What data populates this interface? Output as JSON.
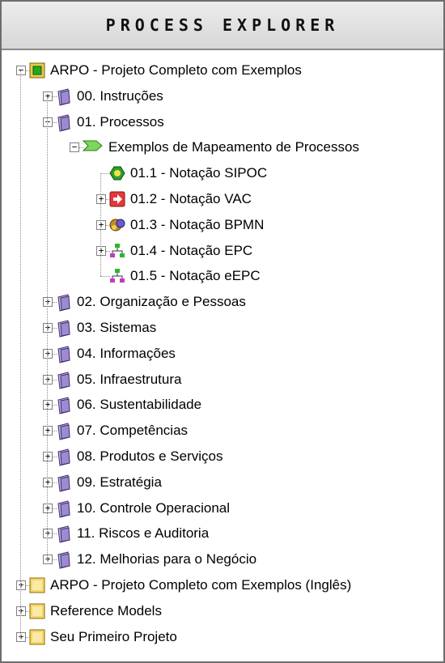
{
  "panel": {
    "title": "PROCESS EXPLORER"
  },
  "tree": [
    {
      "label": "ARPO - Projeto Completo com Exemplos",
      "icon": "project-green-icon",
      "expander": "−"
    },
    {
      "label": "00. Instruções",
      "icon": "folder-icon",
      "expander": "+"
    },
    {
      "label": "01. Processos",
      "icon": "folder-icon",
      "expander": "−"
    },
    {
      "label": "Exemplos de Mapeamento de Processos",
      "icon": "process-chevron-icon",
      "expander": "−"
    },
    {
      "label": "01.1 - Notação SIPOC",
      "icon": "sipoc-hexagon-icon",
      "expander": ""
    },
    {
      "label": "01.2 - Notação VAC",
      "icon": "vac-arrow-icon",
      "expander": "+"
    },
    {
      "label": "01.3 - Notação BPMN",
      "icon": "bpmn-icon",
      "expander": "+"
    },
    {
      "label": "01.4 - Notação EPC",
      "icon": "epc-icon",
      "expander": "+"
    },
    {
      "label": "01.5 - Notação eEPC",
      "icon": "eepc-icon",
      "expander": ""
    },
    {
      "label": "02. Organização e Pessoas",
      "icon": "folder-icon",
      "expander": "+"
    },
    {
      "label": "03. Sistemas",
      "icon": "folder-icon",
      "expander": "+"
    },
    {
      "label": "04. Informações",
      "icon": "folder-icon",
      "expander": "+"
    },
    {
      "label": "05. Infraestrutura",
      "icon": "folder-icon",
      "expander": "+"
    },
    {
      "label": "06. Sustentabilidade",
      "icon": "folder-icon",
      "expander": "+"
    },
    {
      "label": "07. Competências",
      "icon": "folder-icon",
      "expander": "+"
    },
    {
      "label": "08. Produtos e Serviços",
      "icon": "folder-icon",
      "expander": "+"
    },
    {
      "label": "09. Estratégia",
      "icon": "folder-icon",
      "expander": "+"
    },
    {
      "label": "10. Controle Operacional",
      "icon": "folder-icon",
      "expander": "+"
    },
    {
      "label": "11. Riscos e Auditoria",
      "icon": "folder-icon",
      "expander": "+"
    },
    {
      "label": "12. Melhorias para o Negócio",
      "icon": "folder-icon",
      "expander": "+"
    },
    {
      "label": "ARPO - Projeto Completo com Exemplos (Inglês)",
      "icon": "project-yellow-icon",
      "expander": "+"
    },
    {
      "label": "Reference Models",
      "icon": "project-yellow-icon",
      "expander": "+"
    },
    {
      "label": "Seu Primeiro Projeto",
      "icon": "project-yellow-icon",
      "expander": "+"
    }
  ]
}
